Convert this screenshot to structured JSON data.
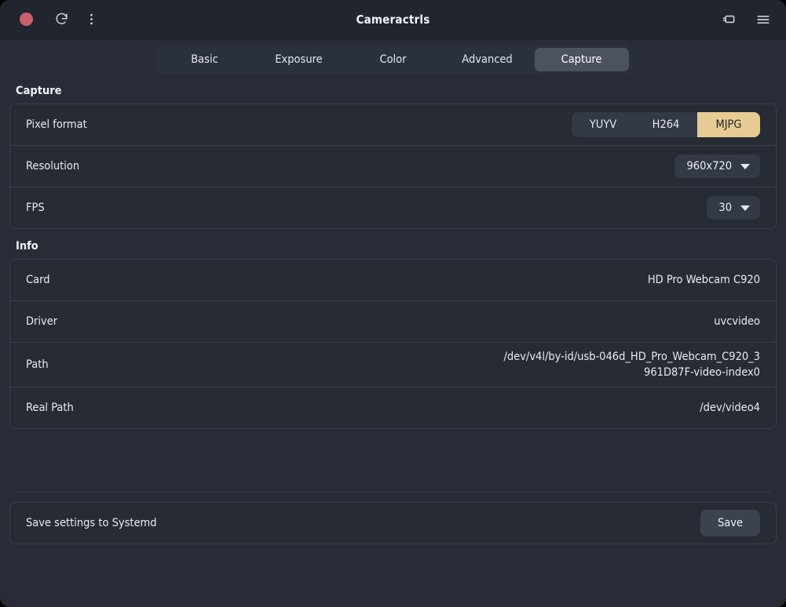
{
  "window": {
    "title": "Cameractrls",
    "close_icon": "close-circle-icon",
    "refresh_icon": "refresh-icon",
    "overflow_icon": "three-dots-vertical-icon",
    "camera_icon": "camera-icon",
    "menu_icon": "hamburger-menu-icon"
  },
  "tabs": [
    {
      "label": "Basic",
      "selected": false
    },
    {
      "label": "Exposure",
      "selected": false
    },
    {
      "label": "Color",
      "selected": false
    },
    {
      "label": "Advanced",
      "selected": false
    },
    {
      "label": "Capture",
      "selected": true
    }
  ],
  "capture": {
    "section_title": "Capture",
    "pixel_format": {
      "label": "Pixel format",
      "options": [
        "YUYV",
        "H264",
        "MJPG"
      ],
      "selected": "MJPG",
      "selected_bg": "#e7cb92",
      "selected_fg": "#1f232b"
    },
    "resolution": {
      "label": "Resolution",
      "value": "960x720"
    },
    "fps": {
      "label": "FPS",
      "value": "30"
    }
  },
  "info": {
    "section_title": "Info",
    "rows": [
      {
        "label": "Card",
        "value": "HD Pro Webcam C920"
      },
      {
        "label": "Driver",
        "value": "uvcvideo"
      },
      {
        "label": "Path",
        "value": "/dev/v4l/by-id/usb-046d_HD_Pro_Webcam_C920_3961D87F-video-index0"
      },
      {
        "label": "Real Path",
        "value": "/dev/video4"
      }
    ]
  },
  "footer": {
    "label": "Save settings to Systemd",
    "save_label": "Save"
  },
  "theme": {
    "window_bg": "#272c36",
    "header_bg": "#21262e",
    "row_bg": "#262b34",
    "border": "#3a404b",
    "accent": "#e7cb92",
    "close_dot": "#c9606b",
    "tab_selected_bg": "#4c525e"
  }
}
